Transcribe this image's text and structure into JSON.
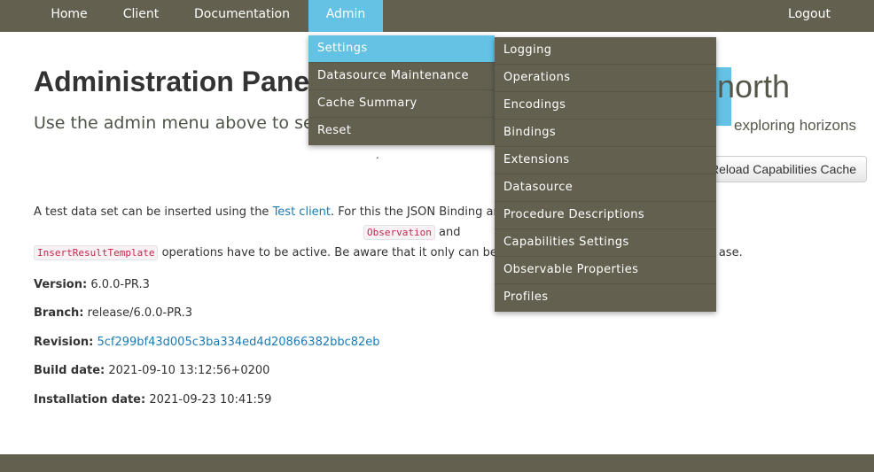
{
  "nav": {
    "home": "Home",
    "client": "Client",
    "documentation": "Documentation",
    "admin": "Admin",
    "logout": "Logout"
  },
  "main": {
    "title": "Administration Panel",
    "subtitle": "Use the admin menu above to select",
    "reload_button": "Reload Capabilities Cache",
    "para1_a": "A test data set can be inserted using the ",
    "para1_link": "Test client",
    "para1_b": ". For this the JSON Binding and",
    "code_observation": "Observation",
    "para1_c": " and",
    "code_insert_result_template": "InsertResultTemplate",
    "para2_a": " operations have to be active. Be aware that it only can be",
    "para2_b": "ase."
  },
  "logo": {
    "word": "north",
    "tagline": "exploring horizons"
  },
  "info": {
    "version_label": "Version:",
    "version": "6.0.0-PR.3",
    "branch_label": "Branch:",
    "branch": "release/6.0.0-PR.3",
    "revision_label": "Revision:",
    "revision": "5cf299bf43d005c3ba334ed4d20866382bbc82eb",
    "build_date_label": "Build date:",
    "build_date": "2021-09-10 13:12:56+0200",
    "installation_date_label": "Installation date:",
    "installation_date": "2021-09-23 10:41:59"
  },
  "admin_menu": [
    {
      "label": "Settings"
    },
    {
      "label": "Datasource Maintenance"
    },
    {
      "label": "Cache Summary"
    },
    {
      "label": "Reset"
    }
  ],
  "settings_menu": [
    {
      "label": "Logging"
    },
    {
      "label": "Operations"
    },
    {
      "label": "Encodings"
    },
    {
      "label": "Bindings"
    },
    {
      "label": "Extensions"
    },
    {
      "label": "Datasource"
    },
    {
      "label": "Procedure Descriptions"
    },
    {
      "label": "Capabilities Settings"
    },
    {
      "label": "Observable Properties"
    },
    {
      "label": "Profiles"
    }
  ],
  "colors": {
    "nav_bg": "#636050",
    "accent": "#64c2e4",
    "link": "#1a7bb5"
  }
}
